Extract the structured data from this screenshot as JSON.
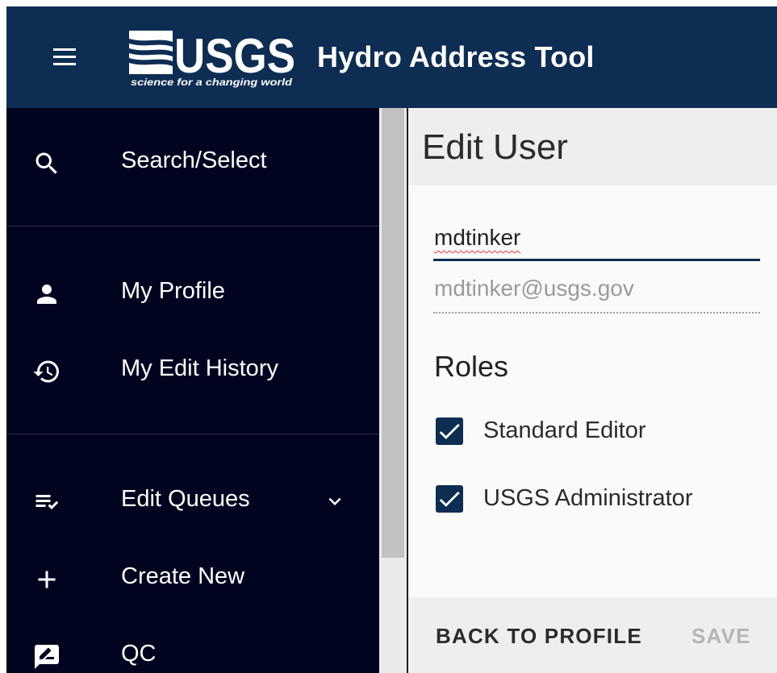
{
  "header": {
    "logo": {
      "wordmark": "USGS",
      "tagline": "science for a changing world"
    },
    "title": "Hydro Address Tool",
    "background_color": "#0e2d52"
  },
  "sidebar": {
    "background_color": "#01041f",
    "items": [
      {
        "label": "Search/Select",
        "icon": "search-icon"
      },
      {
        "label": "My Profile",
        "icon": "person-icon"
      },
      {
        "label": "My Edit History",
        "icon": "history-icon"
      },
      {
        "label": "Edit Queues",
        "icon": "playlist-check-icon",
        "expandable": true,
        "expanded": false
      },
      {
        "label": "Create New",
        "icon": "plus-icon"
      },
      {
        "label": "QC",
        "icon": "rate-review-icon"
      }
    ]
  },
  "panel": {
    "title": "Edit User",
    "username": "mdtinker",
    "email": "mdtinker@usgs.gov",
    "roles_heading": "Roles",
    "roles": [
      {
        "label": "Standard Editor",
        "checked": true
      },
      {
        "label": "USGS Administrator",
        "checked": true
      }
    ],
    "actions": {
      "back_label": "BACK TO PROFILE",
      "save_label": "SAVE",
      "save_enabled": false
    }
  }
}
